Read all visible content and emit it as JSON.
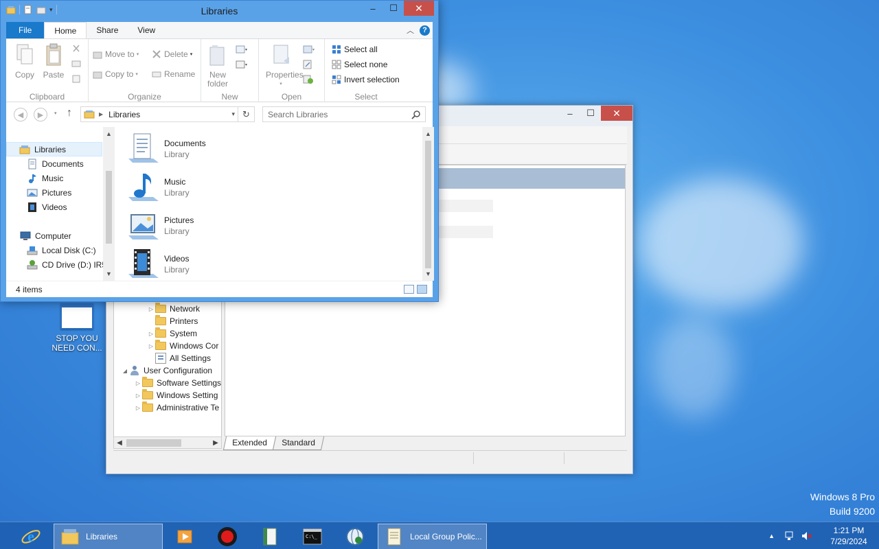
{
  "desktop": {
    "watermark_line1": "Windows 8 Pro",
    "watermark_line2": "Build 9200",
    "icon_label": "STOP YOU NEED CON..."
  },
  "explorer": {
    "title": "Libraries",
    "ribbon_tabs": [
      "File",
      "Home",
      "Share",
      "View"
    ],
    "active_tab": "Home",
    "groups": {
      "clipboard": {
        "name": "Clipboard",
        "copy": "Copy",
        "paste": "Paste"
      },
      "organize": {
        "name": "Organize",
        "move_to": "Move to",
        "copy_to": "Copy to",
        "delete": "Delete",
        "rename": "Rename"
      },
      "new": {
        "name": "New",
        "new_folder_line1": "New",
        "new_folder_line2": "folder"
      },
      "open": {
        "name": "Open",
        "properties": "Properties"
      },
      "select": {
        "name": "Select",
        "select_all": "Select all",
        "select_none": "Select none",
        "invert_selection": "Invert selection"
      }
    },
    "address": {
      "crumb": "Libraries"
    },
    "search": {
      "placeholder": "Search Libraries"
    },
    "nav": {
      "libraries": "Libraries",
      "documents": "Documents",
      "music": "Music",
      "pictures": "Pictures",
      "videos": "Videos",
      "computer": "Computer",
      "local_disk": "Local Disk (C:)",
      "cd_drive": "CD Drive (D:) IR5_"
    },
    "items": [
      {
        "name": "Documents",
        "type": "Library"
      },
      {
        "name": "Music",
        "type": "Library"
      },
      {
        "name": "Pictures",
        "type": "Library"
      },
      {
        "name": "Videos",
        "type": "Library"
      }
    ],
    "status": {
      "count": "4 items"
    }
  },
  "group_policy": {
    "tree": {
      "network": "Network",
      "printers": "Printers",
      "system": "System",
      "windows_components": "Windows Cor",
      "all_settings": "All Settings",
      "user_configuration": "User Configuration",
      "software_settings": "Software Settings",
      "windows_settings": "Windows Setting",
      "administrative_templates": "Administrative Te"
    },
    "tabs": {
      "extended": "Extended",
      "standard": "Standard"
    }
  },
  "taskbar": {
    "libraries": "Libraries",
    "local_group_policy": "Local Group Polic...",
    "time": "1:21 PM",
    "date": "7/29/2024"
  },
  "colors": {
    "accent": "#1979ca",
    "close_button": "#c7504a",
    "window_frame": "#5aa2e8",
    "taskbar": "#1e5faf"
  }
}
